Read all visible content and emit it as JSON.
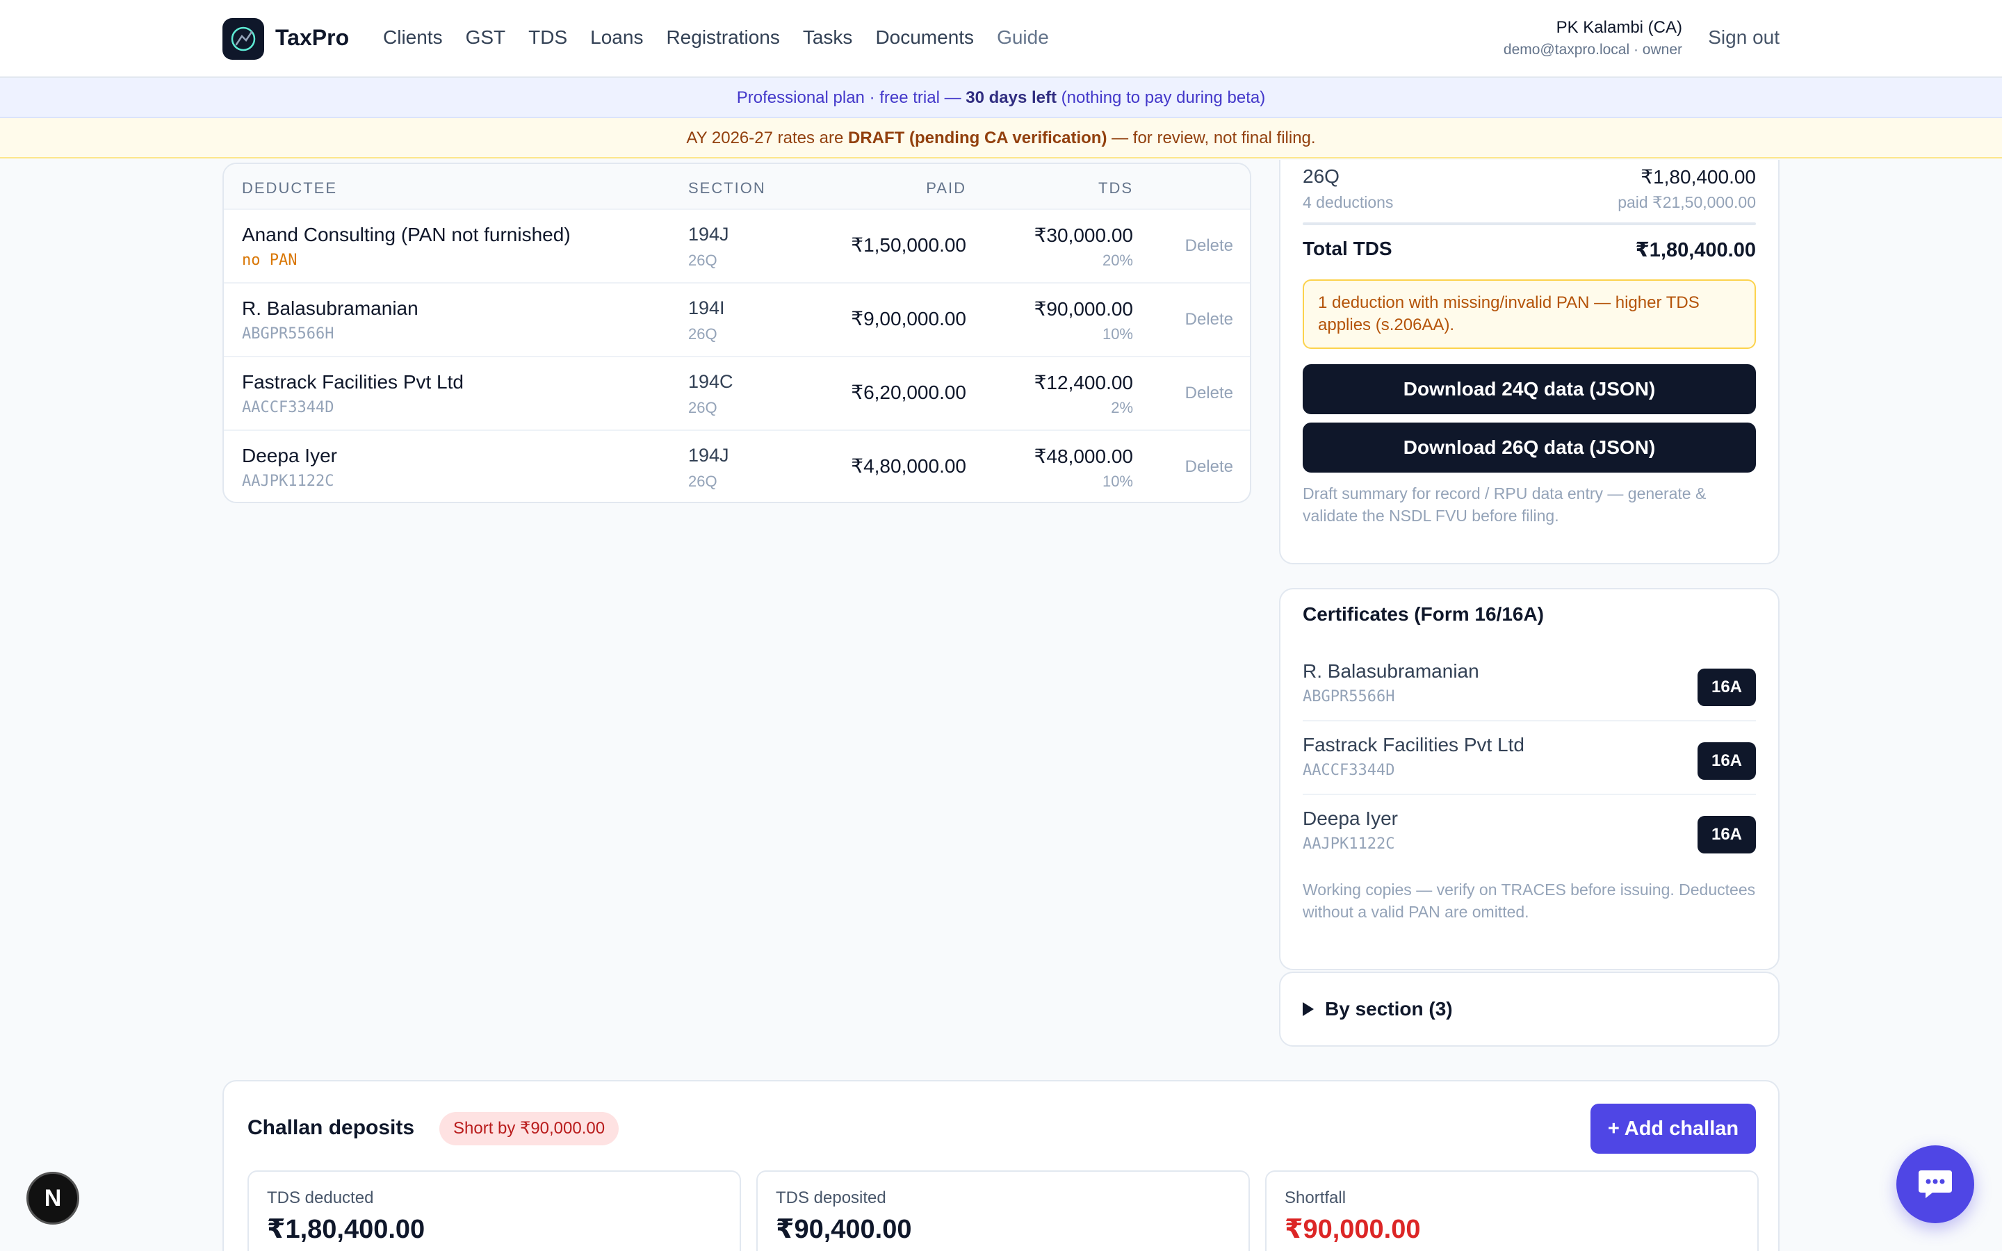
{
  "nav": {
    "brand": "TaxPro",
    "links": [
      "Clients",
      "GST",
      "TDS",
      "Loans",
      "Registrations",
      "Tasks",
      "Documents",
      "Guide"
    ],
    "user_name": "PK Kalambi (CA)",
    "user_email": "demo@taxpro.local · owner",
    "signout": "Sign out"
  },
  "banners": {
    "plan_prefix": "Professional plan · free trial — ",
    "plan_days": "30 days left",
    "plan_suffix": " (nothing to pay during beta)",
    "draft_prefix": "AY 2026-27 rates are ",
    "draft_bold": "DRAFT (pending CA verification)",
    "draft_suffix": " — for review, not final filing."
  },
  "deductees": {
    "headers": {
      "deductee": "DEDUCTEE",
      "section": "SECTION",
      "paid": "PAID",
      "tds": "TDS"
    },
    "rows": [
      {
        "name": "Anand Consulting (PAN not furnished)",
        "pan": "no PAN",
        "section": "194J",
        "form": "26Q",
        "paid": "₹1,50,000.00",
        "tds": "₹30,000.00",
        "rate": "20%",
        "action": "Delete"
      },
      {
        "name": "R. Balasubramanian",
        "pan": "ABGPR5566H",
        "section": "194I",
        "form": "26Q",
        "paid": "₹9,00,000.00",
        "tds": "₹90,000.00",
        "rate": "10%",
        "action": "Delete"
      },
      {
        "name": "Fastrack Facilities Pvt Ltd",
        "pan": "AACCF3344D",
        "section": "194C",
        "form": "26Q",
        "paid": "₹6,20,000.00",
        "tds": "₹12,400.00",
        "rate": "2%",
        "action": "Delete"
      },
      {
        "name": "Deepa Iyer",
        "pan": "AAJPK1122C",
        "section": "194J",
        "form": "26Q",
        "paid": "₹4,80,000.00",
        "tds": "₹48,000.00",
        "rate": "10%",
        "action": "Delete"
      }
    ]
  },
  "summary": {
    "form": "26Q",
    "form_amount": "₹1,80,400.00",
    "deductions": "4 deductions",
    "paid": "paid ₹21,50,000.00",
    "total_label": "Total TDS",
    "total_value": "₹1,80,400.00",
    "pan_warning": "1 deduction with missing/invalid PAN — higher TDS applies (s.206AA).",
    "download_24q": "Download 24Q data (JSON)",
    "download_26q": "Download 26Q data (JSON)",
    "note": "Draft summary for record / RPU data entry — generate & validate the NSDL FVU before filing."
  },
  "certificates": {
    "title": "Certificates (Form 16/16A)",
    "items": [
      {
        "name": "R. Balasubramanian",
        "pan": "ABGPR5566H",
        "badge": "16A"
      },
      {
        "name": "Fastrack Facilities Pvt Ltd",
        "pan": "AACCF3344D",
        "badge": "16A"
      },
      {
        "name": "Deepa Iyer",
        "pan": "AAJPK1122C",
        "badge": "16A"
      }
    ],
    "note": "Working copies — verify on TRACES before issuing. Deductees without a valid PAN are omitted."
  },
  "by_section": {
    "label": "By section (3)"
  },
  "challan": {
    "title": "Challan deposits",
    "short_badge": "Short by ₹90,000.00",
    "add_button": "+ Add challan",
    "stats": [
      {
        "label": "TDS deducted",
        "value": "₹1,80,400.00"
      },
      {
        "label": "TDS deposited",
        "value": "₹90,400.00"
      },
      {
        "label": "Shortfall",
        "value": "₹90,000.00"
      }
    ]
  },
  "floating": {
    "next_badge": "N"
  },
  "colors": {
    "accent": "#4f46e5",
    "dark": "#0f172a",
    "warning": "#d97706",
    "danger": "#dc2626"
  }
}
